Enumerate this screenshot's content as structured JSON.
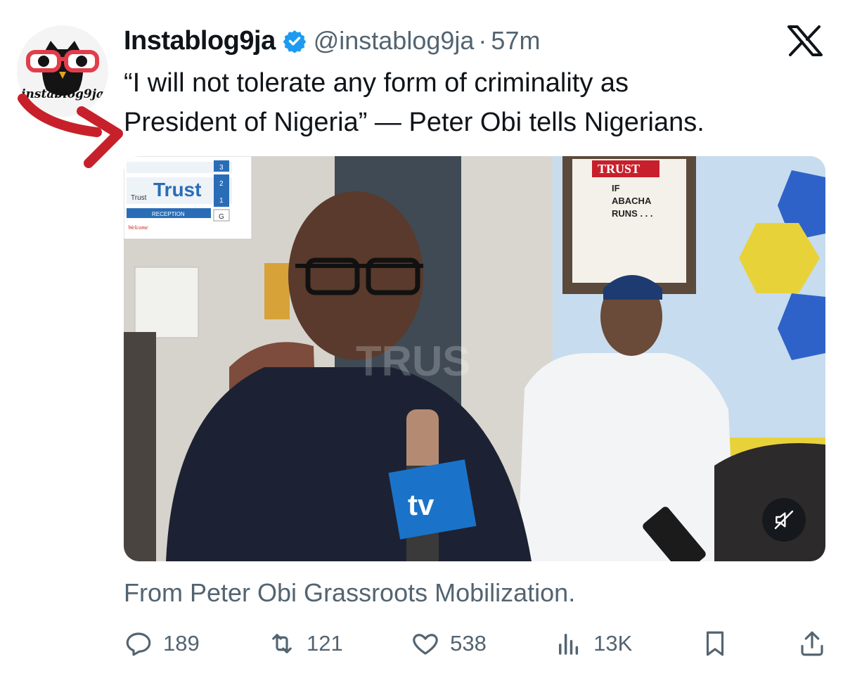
{
  "tweet": {
    "display_name": "Instablog9ja",
    "verified": true,
    "handle": "@instablog9ja",
    "separator": "·",
    "time_ago": "57m",
    "avatar_text": "instablog9ja",
    "text_lines": [
      "“I will not tolerate any form of criminality as",
      "President of Nigeria” — Peter Obi tells Nigerians."
    ],
    "media": {
      "type": "video",
      "muted": true,
      "signs": {
        "trust_board": "Trust",
        "reception": "RECEPTION",
        "trust_small": "Trust",
        "welcome": "Welcome",
        "floor_numbers": [
          "3",
          "2",
          "1",
          "G"
        ],
        "frame_masthead": "TRUST",
        "frame_headline": [
          "IF",
          "ABACHA",
          "RUNS . . ."
        ],
        "watermark": "TRUS",
        "mic_flag": "tv"
      }
    },
    "caption": "From Peter Obi Grassroots Mobilization.",
    "stats": {
      "replies": "189",
      "reposts": "121",
      "likes": "538",
      "views": "13K"
    }
  },
  "icons": {
    "reply": "reply-icon",
    "repost": "repost-icon",
    "like": "heart-icon",
    "views": "views-icon",
    "bookmark": "bookmark-icon",
    "share": "share-icon",
    "mute": "mute-icon",
    "close": "x-logo-icon",
    "verified": "verified-badge-icon"
  },
  "colors": {
    "text_primary": "#0f1419",
    "text_secondary": "#536471",
    "verified_blue": "#1d9bf0",
    "annotation_arrow": "#c8202a"
  }
}
